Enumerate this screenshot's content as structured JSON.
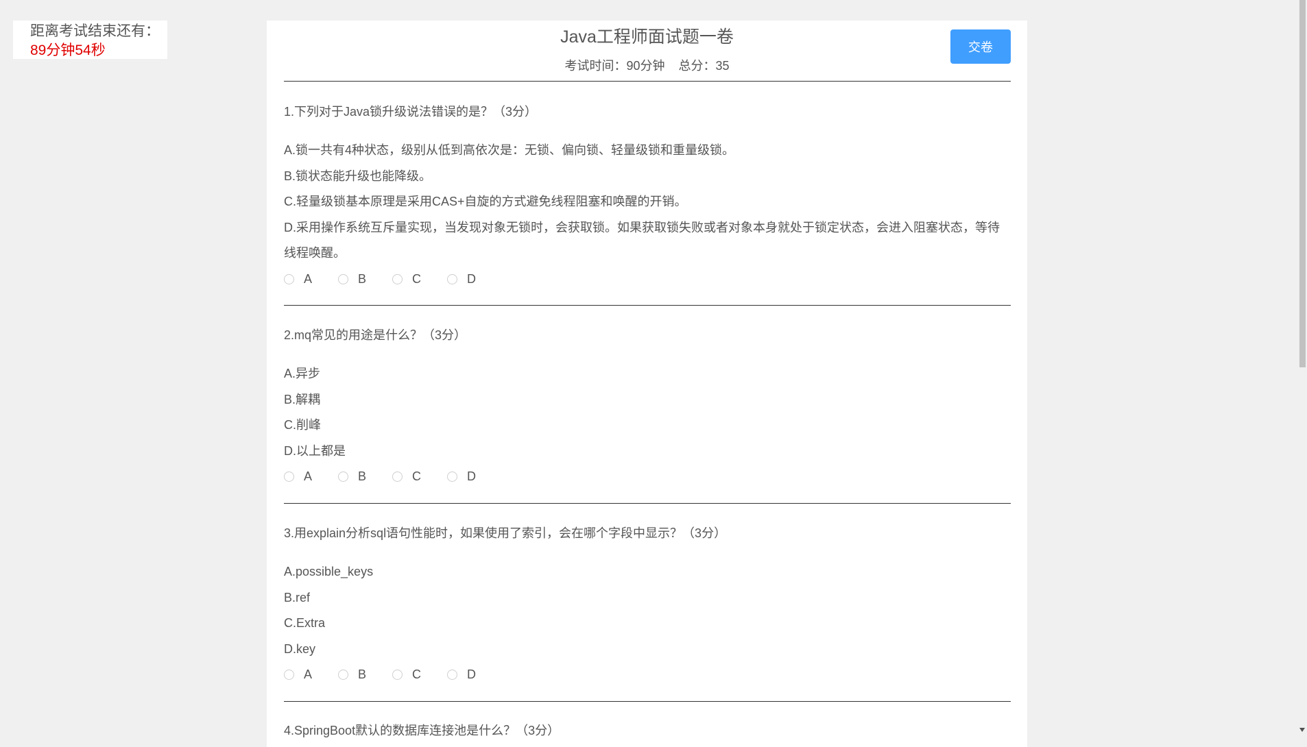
{
  "timer": {
    "label": "距离考试结束还有：",
    "value": "89分钟54秒"
  },
  "exam": {
    "title": "Java工程师面试题一卷",
    "time_label": "考试时间：90分钟",
    "score_label": "总分：35",
    "submit_label": "交卷"
  },
  "questions": [
    {
      "title": "1.下列对于Java锁升级说法错误的是？（3分）",
      "options": [
        "A.锁一共有4种状态，级别从低到高依次是：无锁、偏向锁、轻量级锁和重量级锁。",
        "B.锁状态能升级也能降级。",
        "C.轻量级锁基本原理是采用CAS+自旋的方式避免线程阻塞和唤醒的开销。",
        "D.采用操作系统互斥量实现，当发现对象无锁时，会获取锁。如果获取锁失败或者对象本身就处于锁定状态，会进入阻塞状态，等待线程唤醒。"
      ],
      "choices": [
        "A",
        "B",
        "C",
        "D"
      ]
    },
    {
      "title": "2.mq常见的用途是什么？（3分）",
      "options": [
        "A.异步",
        "B.解耦",
        "C.削峰",
        "D.以上都是"
      ],
      "choices": [
        "A",
        "B",
        "C",
        "D"
      ]
    },
    {
      "title": "3.用explain分析sql语句性能时，如果使用了索引，会在哪个字段中显示？（3分）",
      "options": [
        "A.possible_keys",
        "B.ref",
        "C.Extra",
        "D.key"
      ],
      "choices": [
        "A",
        "B",
        "C",
        "D"
      ]
    },
    {
      "title": "4.SpringBoot默认的数据库连接池是什么？（3分）"
    }
  ]
}
